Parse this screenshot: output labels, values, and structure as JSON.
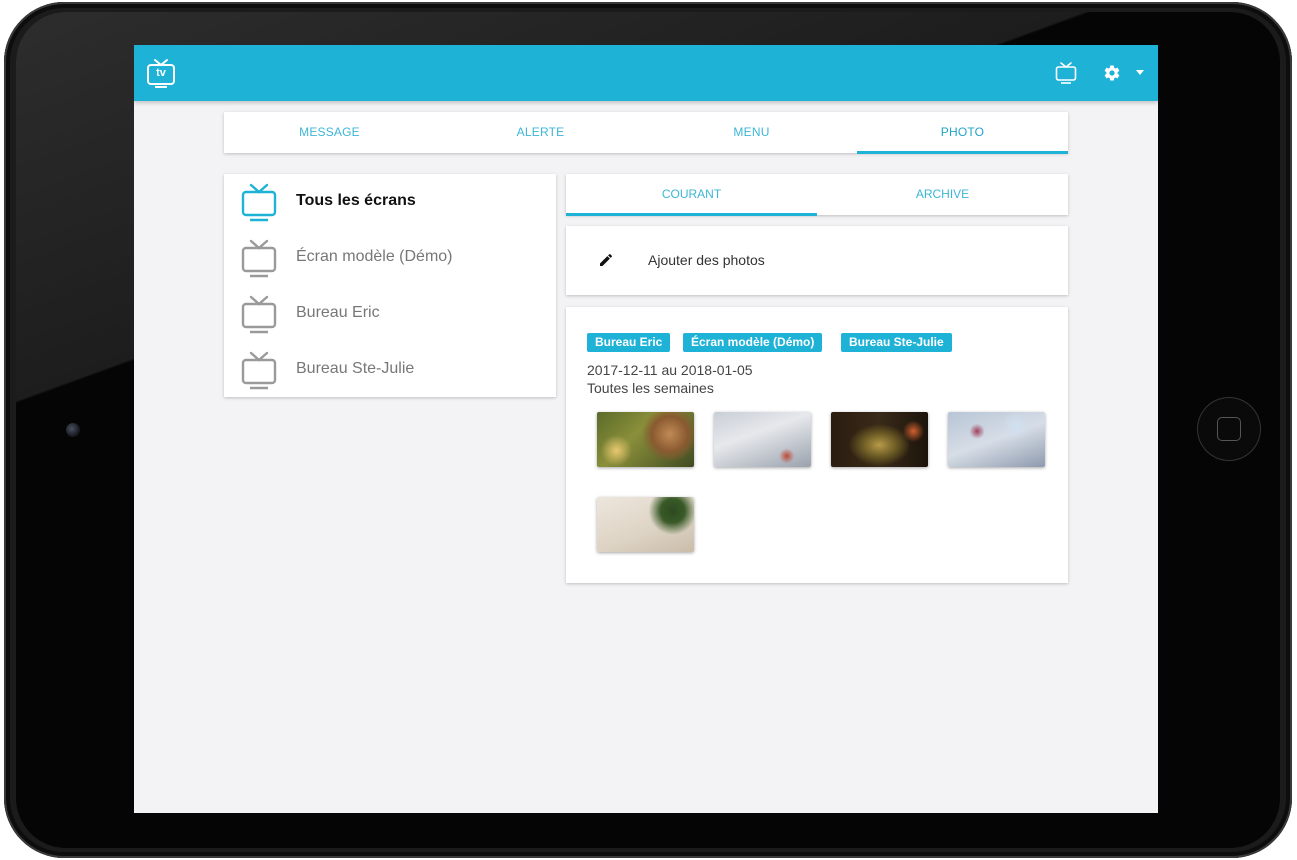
{
  "app": {
    "logo_text": "tv",
    "accent_color": "#1fb2d7"
  },
  "topbar": {
    "icons": [
      "tv-icon",
      "gear-icon",
      "caret-down-icon"
    ]
  },
  "main_tabs": [
    {
      "label": "MESSAGE",
      "active": false
    },
    {
      "label": "ALERTE",
      "active": false
    },
    {
      "label": "MENU",
      "active": false
    },
    {
      "label": "PHOTO",
      "active": true
    }
  ],
  "screens": [
    {
      "label": "Tous les écrans",
      "active": true
    },
    {
      "label": "Écran modèle (Démo)",
      "active": false
    },
    {
      "label": "Bureau Eric",
      "active": false
    },
    {
      "label": "Bureau Ste-Julie",
      "active": false
    }
  ],
  "sub_tabs": [
    {
      "label": "COURANT",
      "active": true
    },
    {
      "label": "ARCHIVE",
      "active": false
    }
  ],
  "add_photos": {
    "label": "Ajouter des photos",
    "icon": "pencil-icon"
  },
  "photo_entry": {
    "tags": [
      "Bureau Eric",
      "Écran modèle (Démo)",
      "Bureau Ste-Julie"
    ],
    "dates": "2017-12-11 au 2018-01-05",
    "frequency": "Toutes les semaines",
    "photos": [
      "photo-1",
      "photo-2",
      "photo-3",
      "photo-4",
      "photo-5"
    ]
  }
}
